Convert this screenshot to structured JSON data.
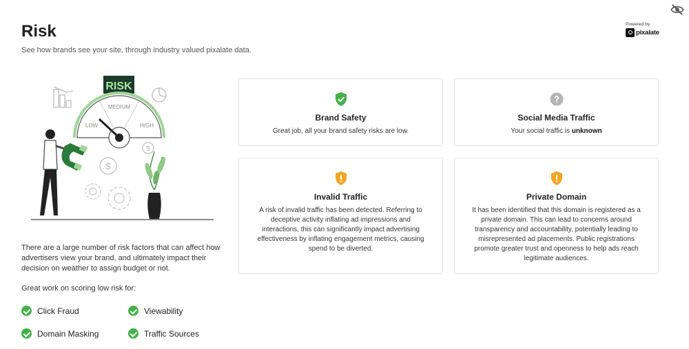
{
  "header": {
    "title": "Risk",
    "subtitle": "See how brands see your site, through industry valued pixalate data.",
    "powered_by": "Powered by",
    "brand": "pixalate"
  },
  "illustration": {
    "sign": "RISK",
    "gauge_low": "LOW",
    "gauge_medium": "MEDIUM",
    "gauge_high": "HIGH",
    "icons": [
      "bar-chart-icon",
      "pie-chart-icon",
      "dollar-coin-icon",
      "gear-icon",
      "plant-vase-icon",
      "magnet-icon"
    ]
  },
  "intro": {
    "text": "There are a large number of risk factors that can affect how advertisers view your brand, and ultimately impact their decision on weather to assign budget or not.",
    "great_work": "Great work on scoring low risk for:"
  },
  "low_risk_items": [
    "Click Fraud",
    "Viewability",
    "Domain Masking",
    "Traffic Sources"
  ],
  "cards": {
    "brand_safety": {
      "title": "Brand Safety",
      "text": "Great job, all your brand safety risks are low.",
      "status": "low"
    },
    "social_media": {
      "title": "Social Media Traffic",
      "text_prefix": "Your social traffic is ",
      "text_value": "unknown",
      "status": "unknown"
    },
    "invalid_traffic": {
      "title": "Invalid Traffic",
      "text": "A risk of invalid traffic has been detected. Referring to deceptive activity inflating ad impressions and interactions, this can significantly impact advertising effectiveness by inflating engagement metrics, causing spend to be diverted.",
      "status": "warning"
    },
    "private_domain": {
      "title": "Private Domain",
      "text": "It has been identified that this domain is registered as a private domain. This can lead to concerns around transparency and accountability, potentially leading to misrepresented ad placements. Public registrations promote greater trust and openness to help ads reach legitimate audiences.",
      "status": "warning"
    }
  },
  "colors": {
    "success": "#43b049",
    "warning": "#f5a623",
    "unknown": "#b5b5b5",
    "risk_sign": "#1c3b2a",
    "risk_sign_text": "#a8e6a1"
  }
}
